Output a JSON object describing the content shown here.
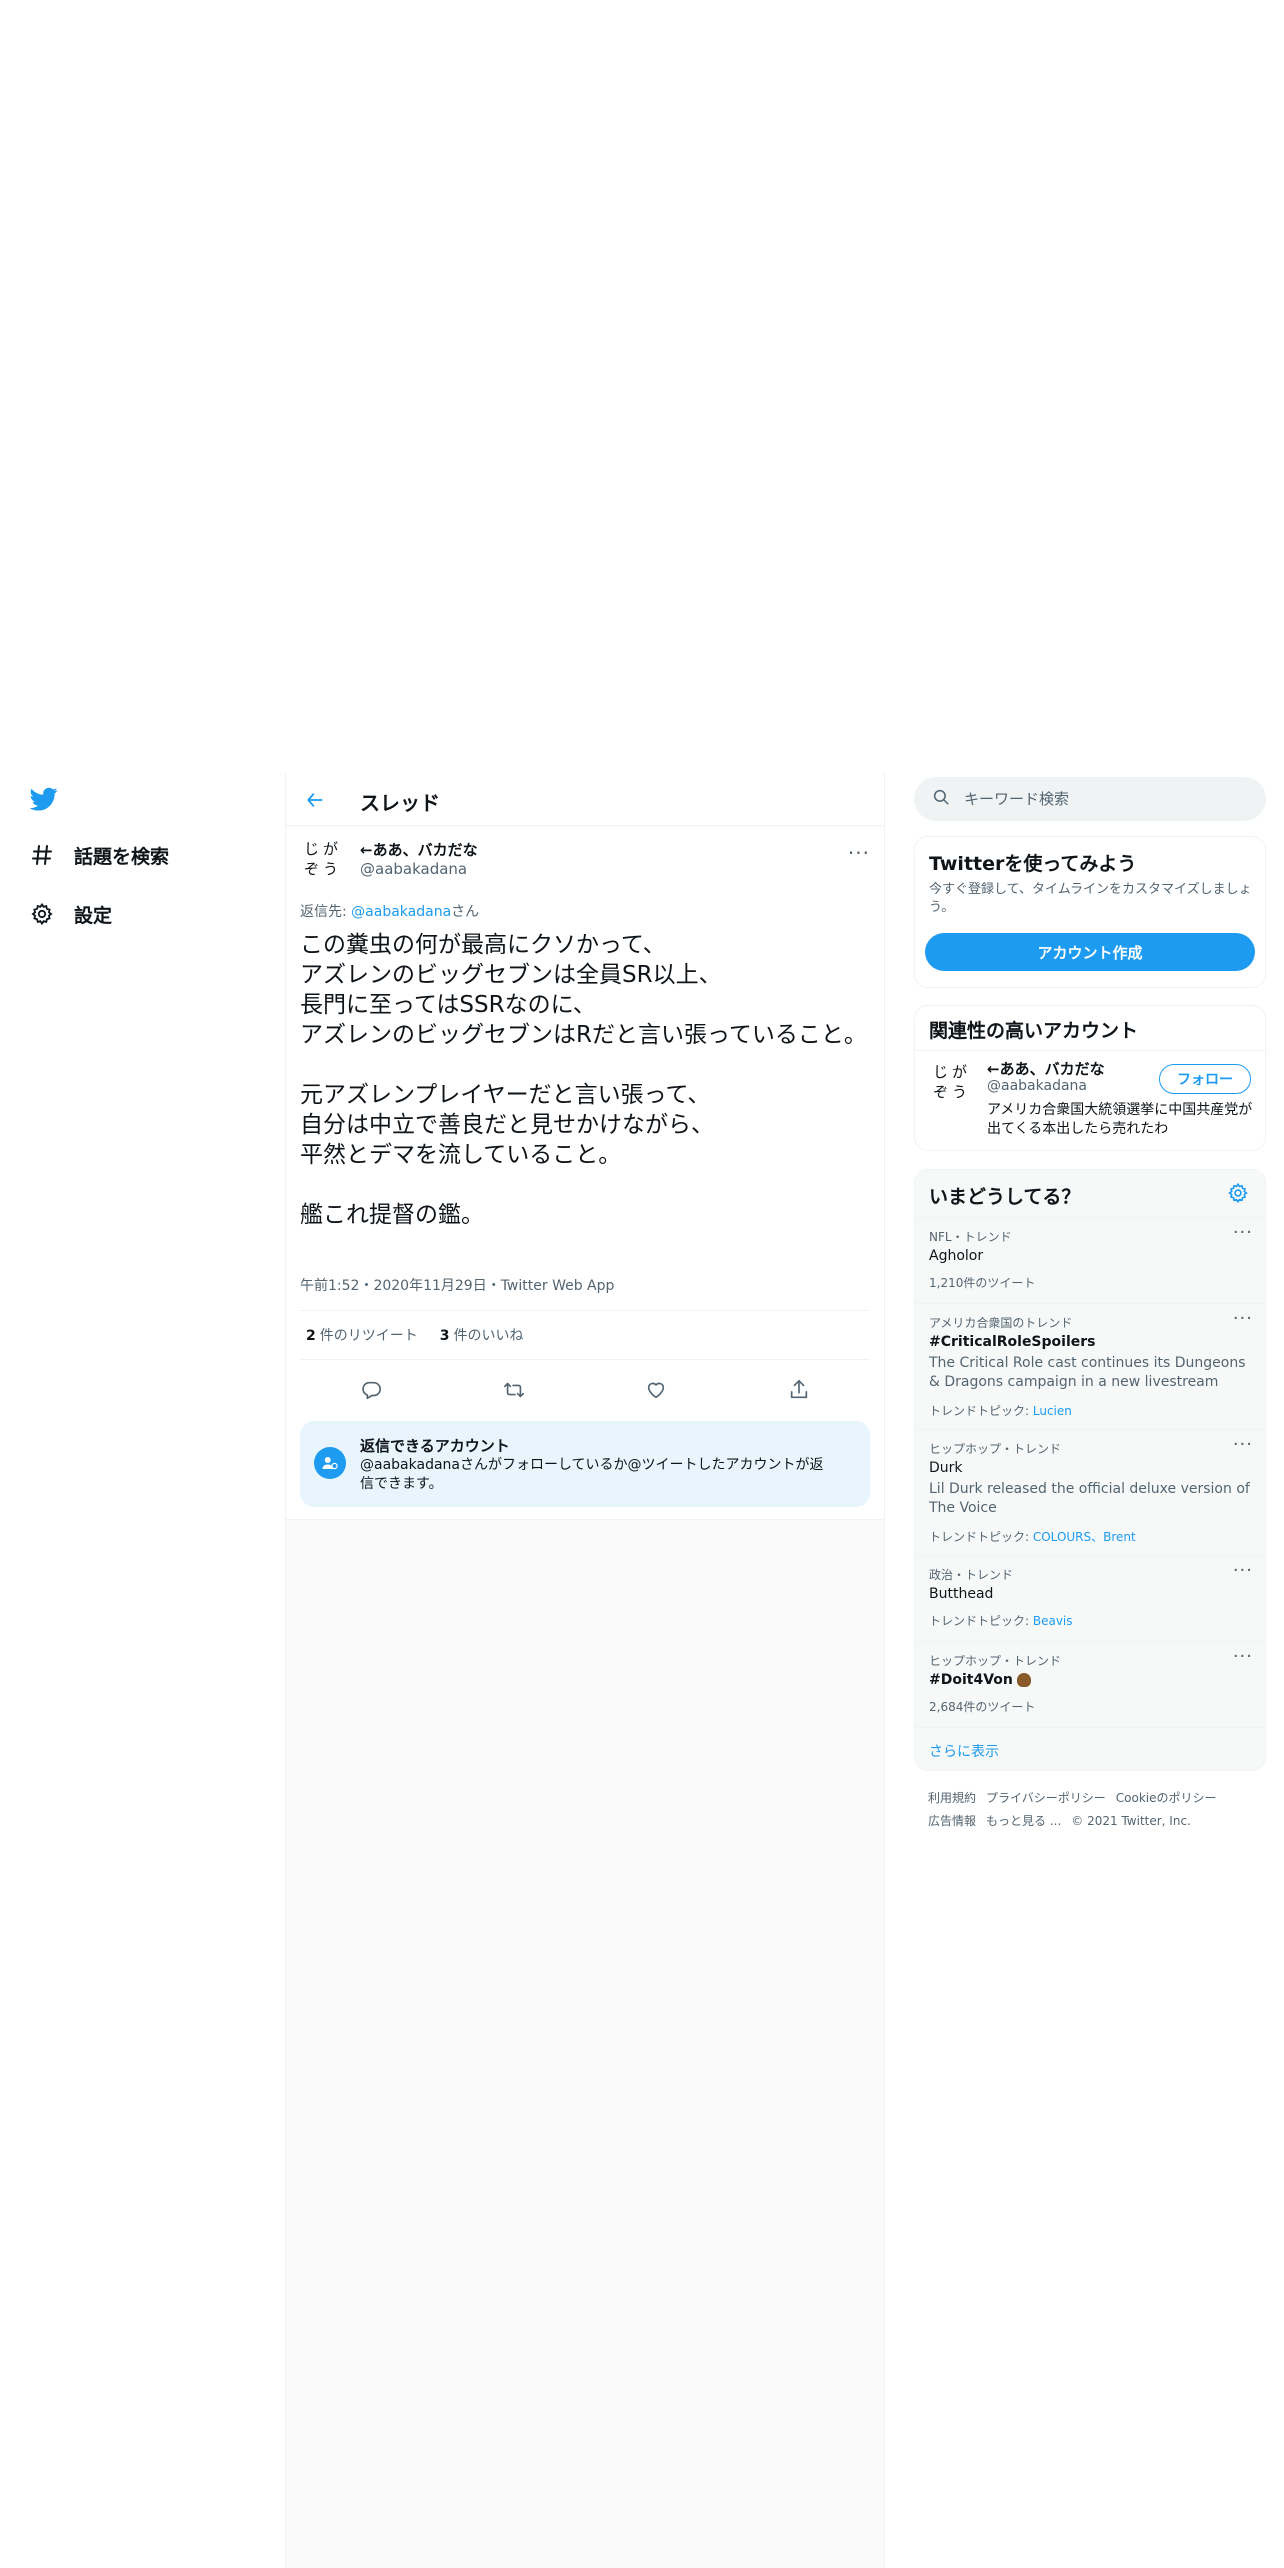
{
  "nav": {
    "items": [
      {
        "label": "話題を検索"
      },
      {
        "label": "設定"
      }
    ]
  },
  "header": {
    "title": "スレッド"
  },
  "tweet": {
    "avatar_text": "じがぞう",
    "display_name": "←ああ、バカだな",
    "handle": "@aabakadana",
    "reply_prefix": "返信先: ",
    "reply_mention": "@aabakadana",
    "reply_suffix": "さん",
    "text": "この糞虫の何が最高にクソかって、\nアズレンのビッグセブンは全員SR以上、\n長門に至ってはSSRなのに、\nアズレンのビッグセブンはRだと言い張っていること。\n\n元アズレンプレイヤーだと言い張って、\n自分は中立で善良だと見せかけながら、\n平然とデマを流していること。\n\n艦これ提督の鑑。",
    "meta": "午前1:52・2020年11月29日・Twitter Web App",
    "retweets_count": "2",
    "retweets_label": "件のリツイート",
    "likes_count": "3",
    "likes_label": "件のいいね"
  },
  "reply_restriction": {
    "title": "返信できるアカウント",
    "description": "@aabakadanaさんがフォローしているか@ツイートしたアカウントが返信できます。"
  },
  "search": {
    "placeholder": "キーワード検索"
  },
  "signup": {
    "title": "Twitterを使ってみよう",
    "subtitle": "今すぐ登録して、タイムラインをカスタマイズしましょう。",
    "button": "アカウント作成"
  },
  "related": {
    "title": "関連性の高いアカウント",
    "avatar_text": "じがぞう",
    "name": "←ああ、バカだな",
    "handle": "@aabakadana",
    "follow": "フォロー",
    "bio": "アメリカ合衆国大統領選挙に中国共産党が出てくる本出したら売れたわ"
  },
  "trends": {
    "title": "いまどうしてる？",
    "items": [
      {
        "category": "NFL・トレンド",
        "title": "Agholor",
        "count": "1,210件のツイート"
      },
      {
        "category": "アメリカ合衆国のトレンド",
        "title": "#CriticalRoleSpoilers",
        "description": "The Critical Role cast continues its Dungeons & Dragons campaign in a new livestream",
        "topic_prefix": "トレンドトピック: ",
        "topics": "Lucien"
      },
      {
        "category": "ヒップホップ・トレンド",
        "title": "Durk",
        "description": "Lil Durk released the official deluxe version of The Voice",
        "topic_prefix": "トレンドトピック: ",
        "topics": "COLOURS、Brent"
      },
      {
        "category": "政治・トレンド",
        "title": "Butthead",
        "topic_prefix": "トレンドトピック: ",
        "topics": "Beavis"
      },
      {
        "category": "ヒップホップ・トレンド",
        "title": "#Doit4Von",
        "count": "2,684件のツイート"
      }
    ],
    "show_more": "さらに表示"
  },
  "footer": {
    "links": [
      "利用規約",
      "プライバシーポリシー",
      "Cookieのポリシー",
      "広告情報",
      "もっと見る ...",
      "© 2021 Twitter, Inc."
    ]
  },
  "colors": {
    "accent": "#1d9bf0",
    "text": "#0f1419",
    "muted": "#536471"
  }
}
